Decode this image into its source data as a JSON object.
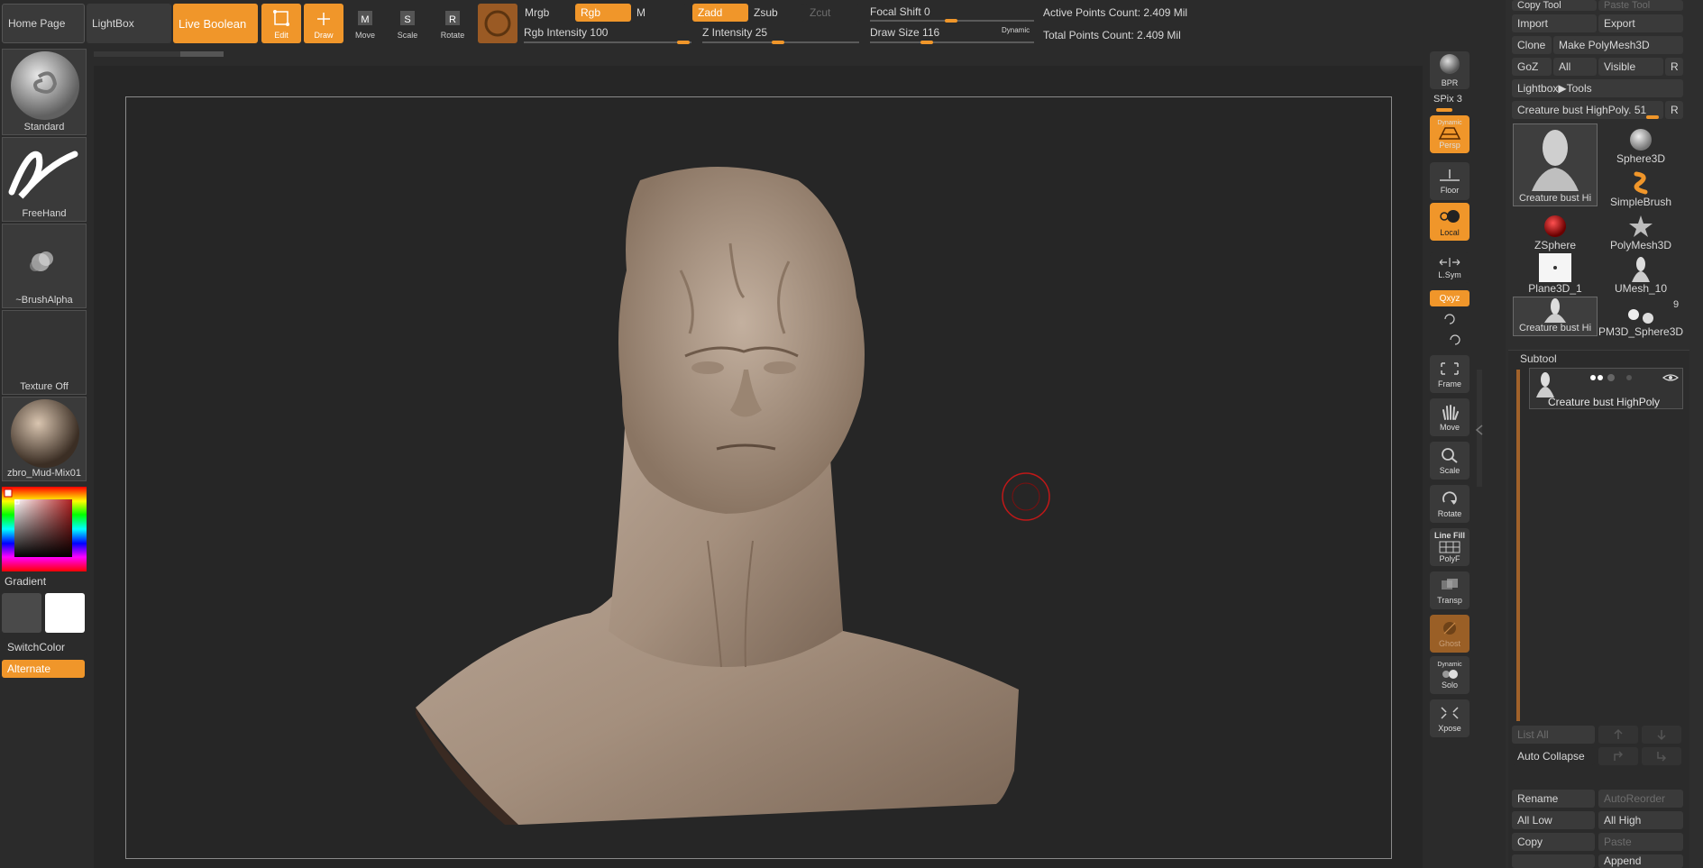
{
  "top": {
    "home_page": "Home Page",
    "lightbox": "LightBox",
    "live_boolean": "Live Boolean",
    "edit": "Edit",
    "draw": "Draw",
    "move": "Move",
    "scale": "Scale",
    "rotate": "Rotate",
    "mrgb": "Mrgb",
    "rgb": "Rgb",
    "m": "M",
    "zadd": "Zadd",
    "zsub": "Zsub",
    "zcut": "Zcut",
    "rgb_intensity_label": "Rgb Intensity",
    "rgb_intensity_value": "100",
    "z_intensity_label": "Z Intensity",
    "z_intensity_value": "25",
    "focal_shift_label": "Focal Shift",
    "focal_shift_value": "0",
    "draw_size_label": "Draw Size",
    "draw_size_value": "116",
    "dynamic": "Dynamic",
    "active_points": "Active Points Count: 2.409 Mil",
    "total_points": "Total Points Count: 2.409 Mil"
  },
  "left": {
    "brush": "Standard",
    "stroke": "FreeHand",
    "alpha": "~BrushAlpha",
    "texture": "Texture Off",
    "material": "zbro_Mud-Mix01",
    "gradient": "Gradient",
    "switch_color": "SwitchColor",
    "alternate": "Alternate"
  },
  "right_shelf": {
    "bpr": "BPR",
    "spix_label": "SPix",
    "spix_value": "3",
    "dynamic": "Dynamic",
    "persp": "Persp",
    "floor": "Floor",
    "local": "Local",
    "lsym": "L.Sym",
    "xyz": "Qxyz",
    "frame": "Frame",
    "move": "Move",
    "scale": "Scale",
    "rotate": "Rotate",
    "line_fill": "Line Fill",
    "polyf": "PolyF",
    "transp": "Transp",
    "ghost": "Ghost",
    "dynamic2": "Dynamic",
    "solo": "Solo",
    "xpose": "Xpose"
  },
  "tool_panel": {
    "copy_tool": "Copy Tool",
    "paste_tool": "Paste Tool",
    "import": "Import",
    "export": "Export",
    "clone": "Clone",
    "make_polymesh": "Make PolyMesh3D",
    "goz": "GoZ",
    "all": "All",
    "visible": "Visible",
    "r": "R",
    "lightbox_tools": "Lightbox▶Tools",
    "current_tool": "Creature bust HighPoly.",
    "current_tool_value": "51",
    "r2": "R",
    "tools": [
      {
        "name": "Creature bust Hi"
      },
      {
        "name": "Sphere3D"
      },
      {
        "name": "SimpleBrush"
      },
      {
        "name": "ZSphere"
      },
      {
        "name": "PolyMesh3D"
      },
      {
        "name": "Plane3D_1"
      },
      {
        "name": "UMesh_10"
      },
      {
        "name": "Creature bust Hi"
      },
      {
        "name": "PM3D_Sphere3D"
      }
    ],
    "tool_count": "9",
    "subtool_header": "Subtool",
    "subtool_item": "Creature bust HighPoly",
    "list_all": "List All",
    "auto_collapse": "Auto Collapse",
    "rename": "Rename",
    "auto_reorder": "AutoReorder",
    "all_low": "All Low",
    "all_high": "All High",
    "copy": "Copy",
    "paste": "Paste",
    "append": "Append"
  }
}
